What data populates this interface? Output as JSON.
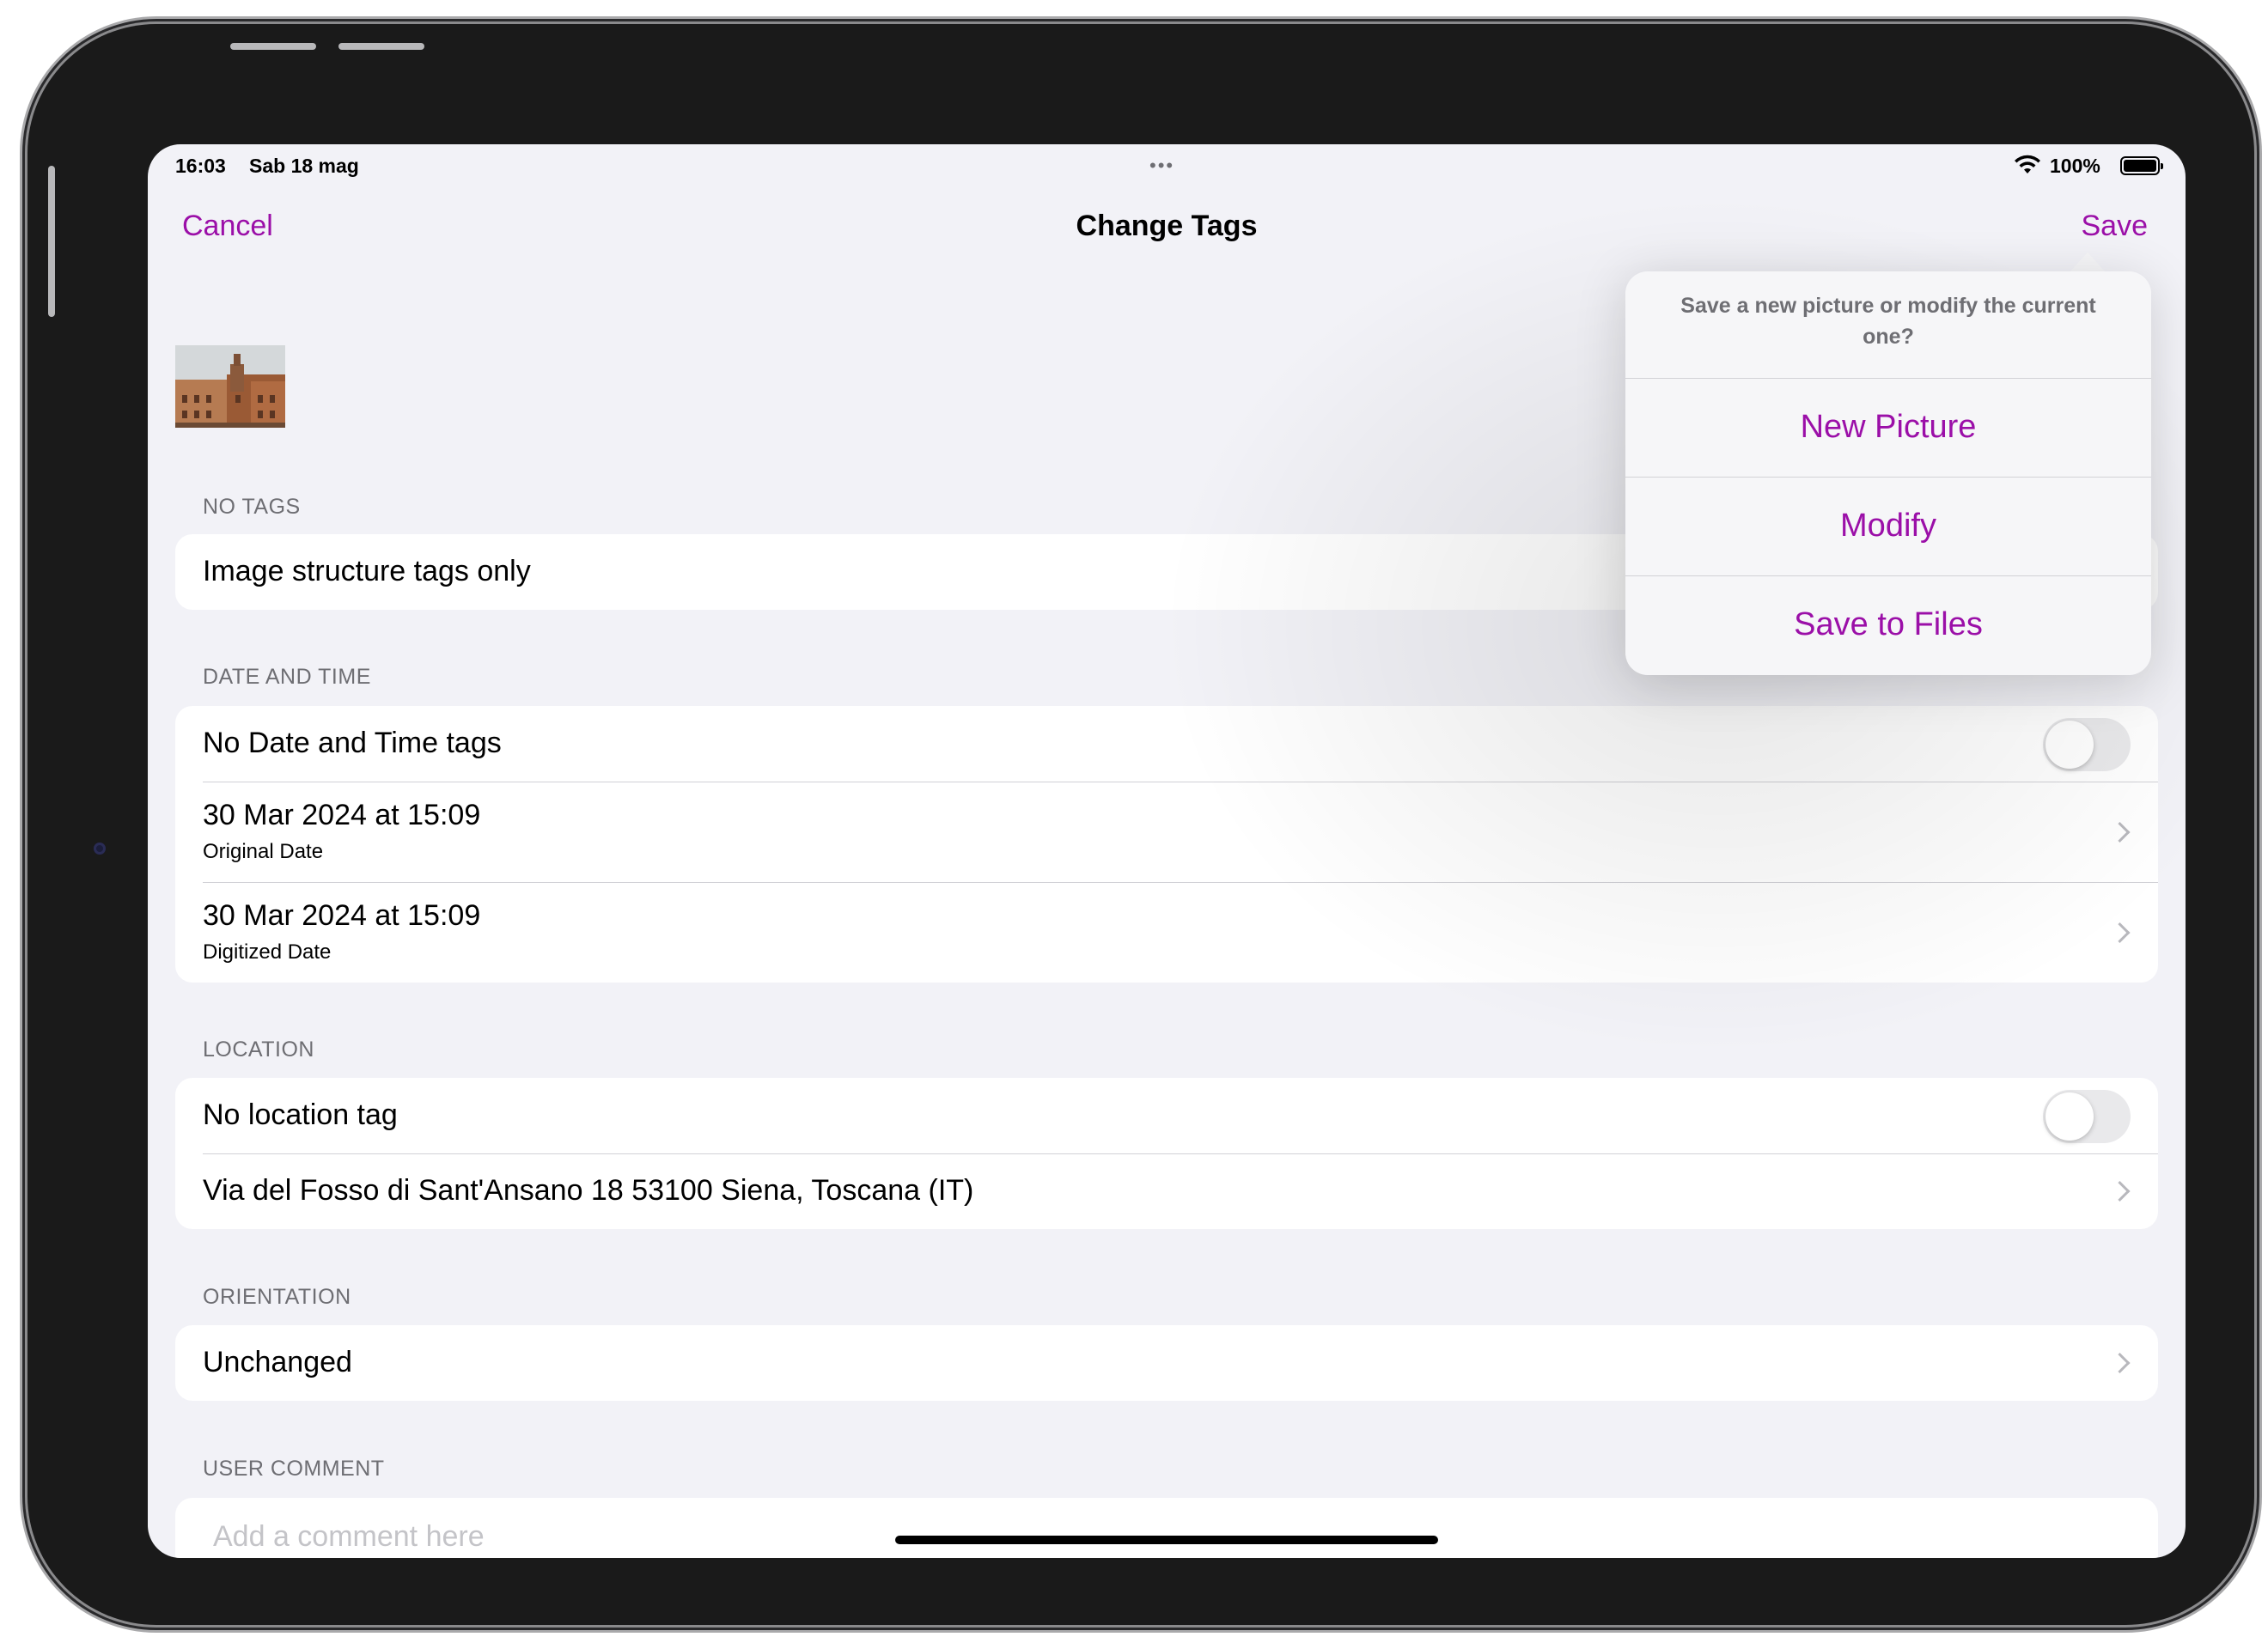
{
  "status_bar": {
    "time": "16:03",
    "date": "Sab 18 mag",
    "multitask_dots": "•••",
    "battery_percent": "100%",
    "battery_level": 1.0
  },
  "nav": {
    "cancel_label": "Cancel",
    "title": "Change Tags",
    "save_label": "Save"
  },
  "sections": {
    "no_tags": {
      "header": "NO TAGS",
      "row_label": "Image structure tags only"
    },
    "date_time": {
      "header": "DATE AND TIME",
      "toggle_label": "No Date and Time tags",
      "toggle_on": false,
      "original": {
        "value": "30 Mar 2024 at 15:09",
        "caption": "Original Date"
      },
      "digitized": {
        "value": "30 Mar 2024 at 15:09",
        "caption": "Digitized Date"
      }
    },
    "location": {
      "header": "LOCATION",
      "toggle_label": "No location tag",
      "toggle_on": false,
      "address": "Via del Fosso di Sant'Ansano 18 53100 Siena, Toscana (IT)"
    },
    "orientation": {
      "header": "ORIENTATION",
      "value": "Unchanged"
    },
    "user_comment": {
      "header": "USER COMMENT",
      "placeholder": "Add a comment here"
    }
  },
  "popover": {
    "message": "Save a new picture or modify the current one?",
    "buttons": [
      "New Picture",
      "Modify",
      "Save to Files"
    ]
  },
  "colors": {
    "accent": "#9b0fa8",
    "background": "#f2f2f7",
    "cell": "#ffffff",
    "secondary_text": "#6e6e73"
  }
}
